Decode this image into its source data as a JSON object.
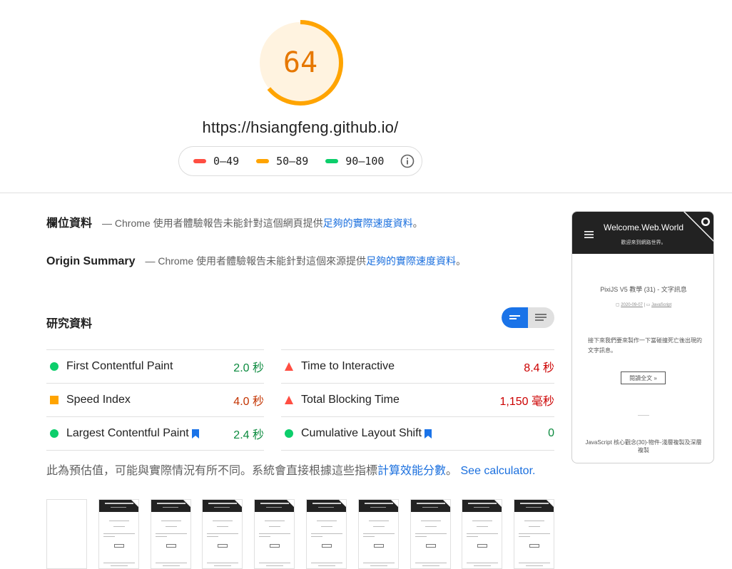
{
  "header": {
    "score": "64",
    "score_fraction": 0.64,
    "url": "https://hsiangfeng.github.io/",
    "legend": [
      {
        "range": "0–49",
        "color": "#ff4e42"
      },
      {
        "range": "50–89",
        "color": "#ffa400"
      },
      {
        "range": "90–100",
        "color": "#0cce6b"
      }
    ],
    "gauge_color": "#ffa400",
    "gauge_bg": "#fff3e0"
  },
  "field_data": {
    "title": "欄位資料",
    "desc": "— Chrome 使用者體驗報告未能針對這個網頁提供",
    "link": "足夠的實際速度資料",
    "end": "。"
  },
  "origin_summary": {
    "title": "Origin Summary",
    "desc": "— Chrome 使用者體驗報告未能針對這個來源提供",
    "link": "足夠的實際速度資料",
    "end": "。"
  },
  "lab_data": {
    "title": "研究資料",
    "metrics": [
      {
        "label": "First Contentful Paint",
        "value": "2.0 秒",
        "status": "pass",
        "bookmark": false
      },
      {
        "label": "Time to Interactive",
        "value": "8.4 秒",
        "status": "fail",
        "bookmark": false
      },
      {
        "label": "Speed Index",
        "value": "4.0 秒",
        "status": "average",
        "bookmark": false
      },
      {
        "label": "Total Blocking Time",
        "value": "1,150 毫秒",
        "status": "fail",
        "bookmark": false
      },
      {
        "label": "Largest Contentful Paint",
        "value": "2.4 秒",
        "status": "pass",
        "bookmark": true
      },
      {
        "label": "Cumulative Layout Shift",
        "value": "0",
        "status": "pass",
        "bookmark": true
      }
    ],
    "colors": {
      "pass": "#0cce6b",
      "average": "#ffa400",
      "fail": "#ff4e42",
      "pass_text": "#0b8a3e",
      "average_text": "#c33300",
      "fail_text": "#cc0000",
      "bookmark": "#1a73e8"
    }
  },
  "note": {
    "text": "此為預估值，可能與實際情況有所不同。系統會直接根據這些指標",
    "link1": "計算效能分數",
    "sep": "。",
    "link2": "See calculator."
  },
  "screenshot": {
    "site_title": "Welcome.Web.World",
    "site_subtitle": "歡迎來到網路世界。",
    "post_title": "PixiJS V5 教學 (31) - 文字訊息",
    "post_date": "2020-09-07",
    "post_category": "JavaScript",
    "excerpt": "接下來我們要來製作一下當碰撞死亡後出現的文字訊息。",
    "button": "閱讀全文 »",
    "next_title": "JavaScript 核心觀念(30)-物件-淺層複製及深層複製"
  }
}
